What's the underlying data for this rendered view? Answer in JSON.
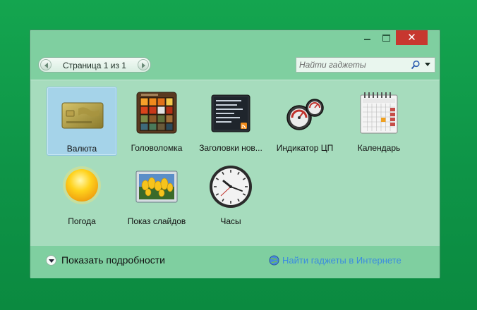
{
  "window": {
    "controls": {
      "minimize_icon": "minimize-icon",
      "maximize_icon": "maximize-icon",
      "close_icon": "close-icon",
      "close_glyph": "✕"
    }
  },
  "pager": {
    "label": "Страница 1 из 1"
  },
  "search": {
    "placeholder": "Найти гаджеты"
  },
  "gadgets": [
    {
      "label": "Валюта",
      "icon": "currency-card-icon",
      "selected": true
    },
    {
      "label": "Головоломка",
      "icon": "puzzle-icon",
      "selected": false
    },
    {
      "label": "Заголовки нов...",
      "icon": "feed-headlines-icon",
      "selected": false
    },
    {
      "label": "Индикатор ЦП",
      "icon": "cpu-meter-icon",
      "selected": false
    },
    {
      "label": "Календарь",
      "icon": "calendar-icon",
      "selected": false
    },
    {
      "label": "Погода",
      "icon": "weather-sun-icon",
      "selected": false
    },
    {
      "label": "Показ слайдов",
      "icon": "slideshow-icon",
      "selected": false
    },
    {
      "label": "Часы",
      "icon": "clock-icon",
      "selected": false
    }
  ],
  "footer": {
    "details_label": "Показать подробности",
    "online_link": "Найти гаджеты в Интернете"
  },
  "colors": {
    "desktop": "#0e9447",
    "window_frame": "#7fcfa0",
    "gallery_bg": "#a6dcbd",
    "selection": "#a5d3e9",
    "close_button": "#c7372f",
    "link": "#3a8be0"
  }
}
